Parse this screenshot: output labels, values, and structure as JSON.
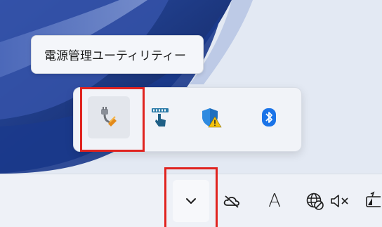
{
  "tooltip": {
    "text": "電源管理ユーティリティー"
  },
  "overflow_flyout": {
    "icons": [
      {
        "name": "power-plug-icon",
        "selected": true,
        "accent": "#e38a1a"
      },
      {
        "name": "touchpad-icon",
        "selected": false,
        "accent": "#2a7aa8"
      },
      {
        "name": "security-shield-warning-icon",
        "selected": false,
        "accent": "#1e6fbf"
      },
      {
        "name": "bluetooth-icon",
        "selected": false,
        "accent": "#1a73e8"
      }
    ]
  },
  "taskbar": {
    "items": [
      {
        "name": "show-hidden-icons-chevron-icon"
      },
      {
        "name": "onedrive-offline-icon"
      },
      {
        "name": "ime-mode-indicator",
        "text": "A"
      },
      {
        "name": "network-globe-icon"
      },
      {
        "name": "speaker-muted-icon"
      },
      {
        "name": "battery-icon"
      }
    ]
  },
  "highlight_color": "#e0231f"
}
